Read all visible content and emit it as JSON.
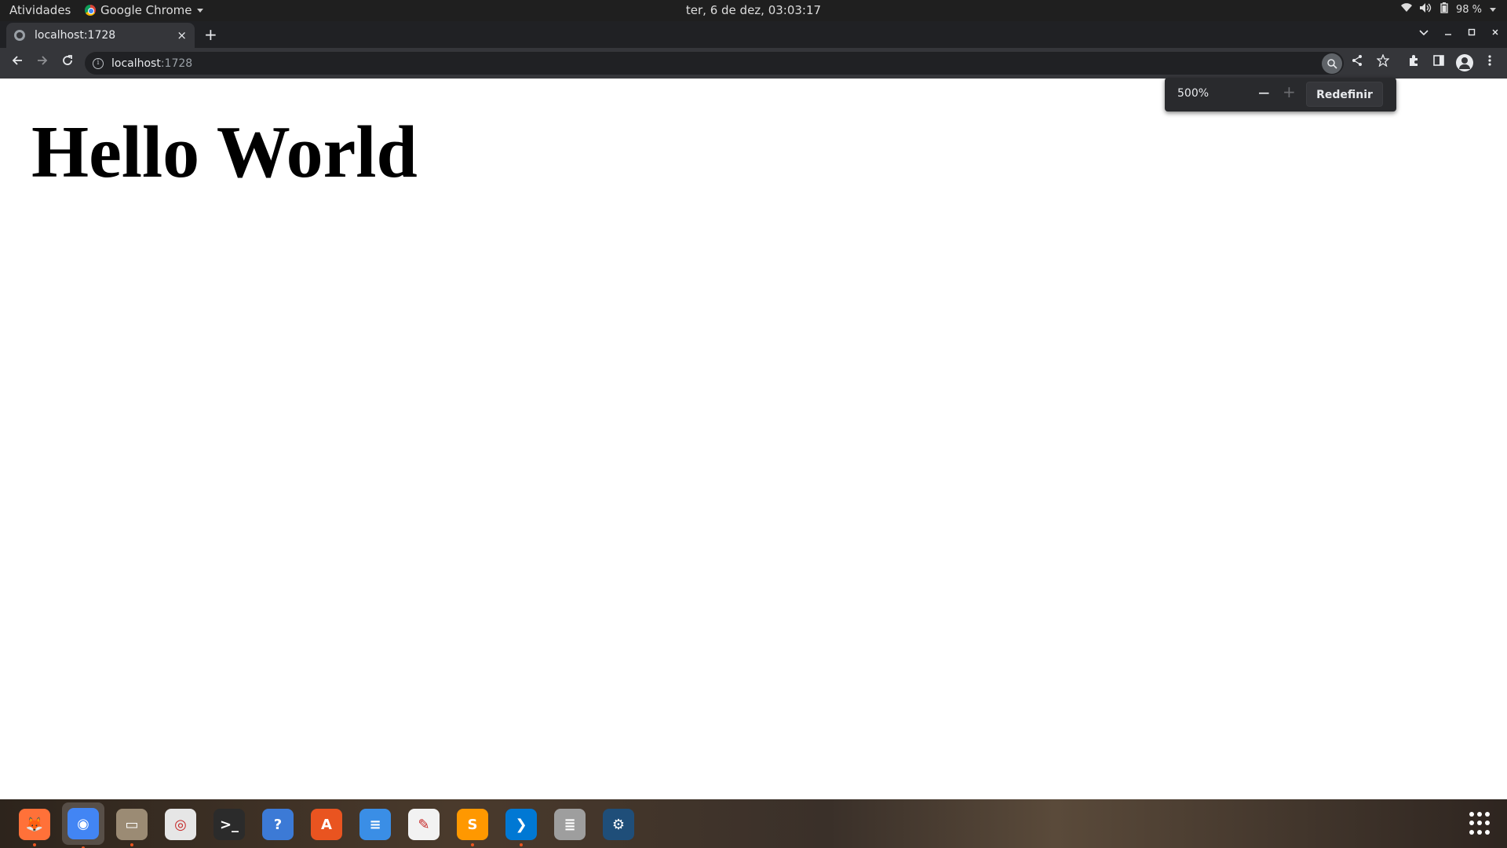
{
  "topbar": {
    "activities": "Atividades",
    "app_name": "Google Chrome",
    "clock": "ter,  6 de dez, 03:03:17",
    "battery": "98 %"
  },
  "browser": {
    "tab": {
      "title": "localhost:1728",
      "close": "×"
    },
    "new_tab": "+",
    "omnibox": {
      "host": "localhost",
      "port": ":1728"
    },
    "zoom_bubble": {
      "level": "500%",
      "minus": "−",
      "plus": "+",
      "reset_label": "Redefinir"
    }
  },
  "page": {
    "heading": "Hello World"
  },
  "dock": {
    "apps": [
      {
        "name": "Firefox",
        "icon": "firefox-icon",
        "color": "#ff7139",
        "running": true
      },
      {
        "name": "Google Chrome",
        "icon": "chrome-icon",
        "color": "#4285f4",
        "running": true,
        "active": true
      },
      {
        "name": "Files",
        "icon": "files-icon",
        "color": "#9b8b74",
        "running": true
      },
      {
        "name": "Rhythmbox",
        "icon": "rhythmbox-icon",
        "color": "#e6e6e6",
        "running": false
      },
      {
        "name": "Terminal",
        "icon": "terminal-icon",
        "color": "#2b2b2b",
        "running": false
      },
      {
        "name": "Help",
        "icon": "help-icon",
        "color": "#3c7ad6",
        "running": false
      },
      {
        "name": "Ubuntu Software",
        "icon": "software-icon",
        "color": "#e95420",
        "running": false
      },
      {
        "name": "Text Editor",
        "icon": "text-editor-icon",
        "color": "#3a8ee6",
        "running": false
      },
      {
        "name": "Document Viewer",
        "icon": "document-viewer-icon",
        "color": "#f2f2f2",
        "running": false
      },
      {
        "name": "Sublime Text",
        "icon": "sublime-icon",
        "color": "#ff9800",
        "running": true
      },
      {
        "name": "Visual Studio Code",
        "icon": "vscode-icon",
        "color": "#0078d4",
        "running": true
      },
      {
        "name": "Database",
        "icon": "database-icon",
        "color": "#9e9e9e",
        "running": false
      },
      {
        "name": "MySQL Workbench",
        "icon": "mysql-icon",
        "color": "#1f4e79",
        "running": false
      }
    ]
  }
}
